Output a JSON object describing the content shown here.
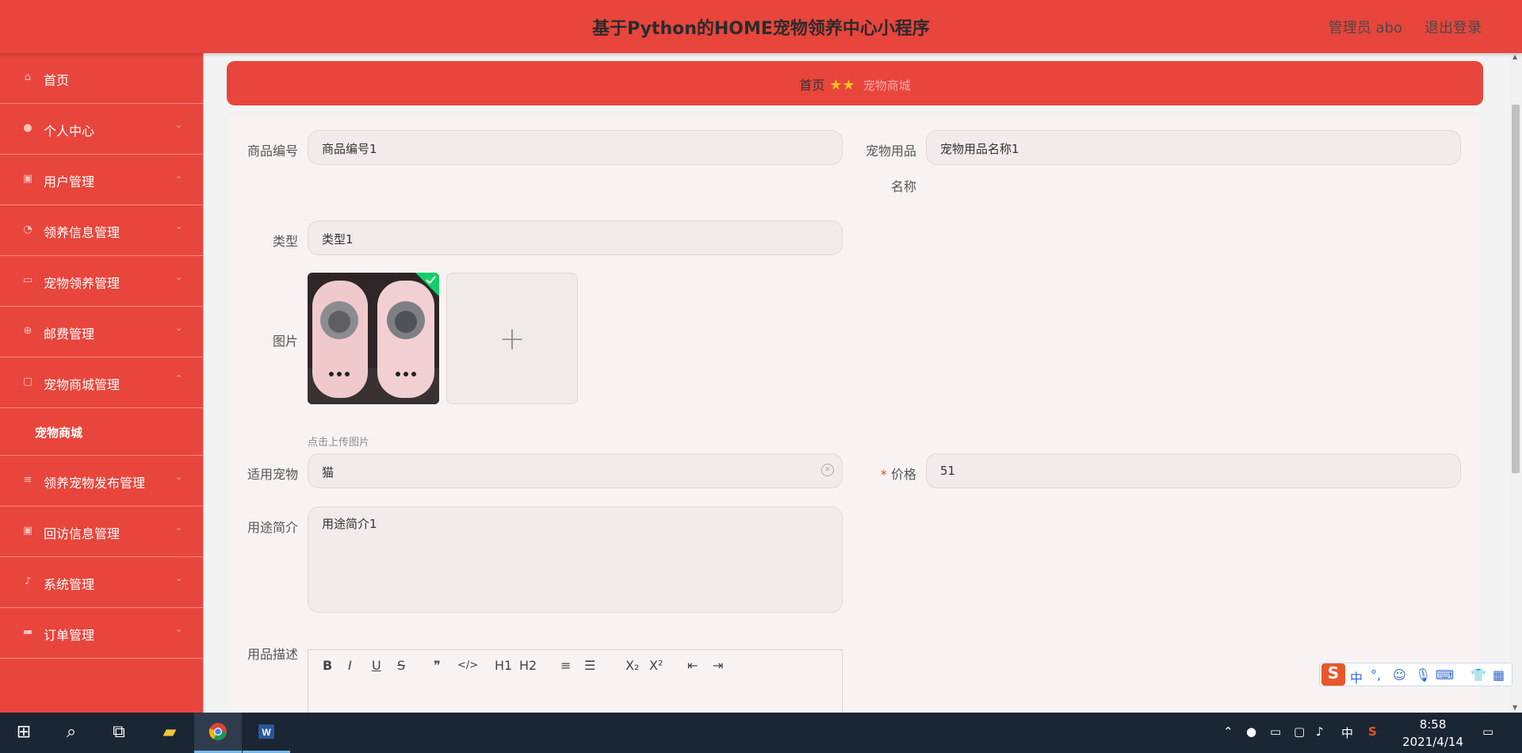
{
  "header": {
    "title": "基于Python的HOME宠物领养中心小程序",
    "user": "管理员 abo",
    "logout": "退出登录"
  },
  "sidebar": {
    "items": [
      {
        "label": "首页",
        "icon": "home-icon"
      },
      {
        "label": "个人中心",
        "icon": "user-icon"
      },
      {
        "label": "用户管理",
        "icon": "clipboard-icon"
      },
      {
        "label": "领养信息管理",
        "icon": "gauge-icon"
      },
      {
        "label": "宠物领养管理",
        "icon": "picture-icon"
      },
      {
        "label": "邮费管理",
        "icon": "dial-icon"
      },
      {
        "label": "宠物商城管理",
        "icon": "chat-icon"
      },
      {
        "label": "领养宠物发布管理",
        "icon": "list-icon"
      },
      {
        "label": "回访信息管理",
        "icon": "clipboard-icon"
      },
      {
        "label": "系统管理",
        "icon": "mic-icon"
      },
      {
        "label": "订单管理",
        "icon": "ticket-icon"
      }
    ],
    "sub_item": "宠物商城"
  },
  "breadcrumb": {
    "home": "首页",
    "current": "宠物商城"
  },
  "form": {
    "product_no": {
      "label": "商品编号",
      "value": "商品编号1"
    },
    "product_name": {
      "label_line1": "宠物用品",
      "label_line2": "名称",
      "value": "宠物用品名称1"
    },
    "type": {
      "label": "类型",
      "value": "类型1"
    },
    "image": {
      "label": "图片",
      "hint": "点击上传图片"
    },
    "suitable_pet": {
      "label": "适用宠物",
      "value": "猫"
    },
    "price": {
      "required": "*",
      "label": "价格",
      "value": "51"
    },
    "usage": {
      "label": "用途简介",
      "value": "用途简介1"
    },
    "description": {
      "label": "用品描述"
    }
  },
  "editor_toolbar": [
    "B",
    "I",
    "U",
    "S",
    "❞",
    "</>",
    "H1",
    "H2",
    "≡",
    "☰",
    "X₂",
    "X²",
    "⇤",
    "⇥"
  ],
  "ime": [
    "中",
    "°,",
    "☺",
    "🎙",
    "⌨",
    "👕",
    "▦"
  ],
  "taskbar": {
    "tray_lang": "中",
    "time": "8:58",
    "date": "2021/4/14"
  },
  "colors": {
    "accent": "#e8453c",
    "taskbar": "#1b2634"
  }
}
